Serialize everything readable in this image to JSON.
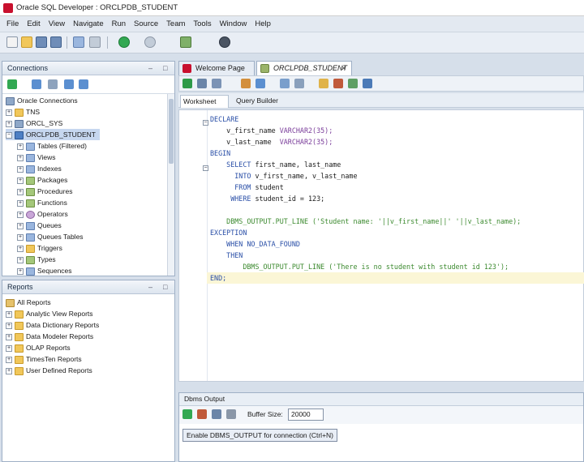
{
  "window": {
    "title": "Oracle SQL Developer : ORCLPDB_STUDENT"
  },
  "menu": [
    "File",
    "Edit",
    "View",
    "Navigate",
    "Run",
    "Source",
    "Team",
    "Tools",
    "Window",
    "Help"
  ],
  "connections": {
    "title": "Connections",
    "items": [
      {
        "label": "Oracle Connections",
        "icon": "connections-root-icon"
      },
      {
        "label": "TNS",
        "icon": "folder-icon"
      },
      {
        "label": "ORCL_SYS",
        "icon": "database-icon"
      },
      {
        "label": "ORCLPDB_STUDENT",
        "icon": "database-active-icon"
      },
      {
        "label": "Tables (Filtered)",
        "icon": "table-icon"
      },
      {
        "label": "Views",
        "icon": "view-icon"
      },
      {
        "label": "Indexes",
        "icon": "index-icon"
      },
      {
        "label": "Packages",
        "icon": "package-icon"
      },
      {
        "label": "Procedures",
        "icon": "procedure-icon"
      },
      {
        "label": "Functions",
        "icon": "function-icon"
      },
      {
        "label": "Operators",
        "icon": "operator-icon"
      },
      {
        "label": "Queues",
        "icon": "queue-icon"
      },
      {
        "label": "Queues Tables",
        "icon": "queue-table-icon"
      },
      {
        "label": "Triggers",
        "icon": "trigger-icon"
      },
      {
        "label": "Types",
        "icon": "type-icon"
      },
      {
        "label": "Sequences",
        "icon": "sequence-icon"
      }
    ]
  },
  "reports": {
    "title": "Reports",
    "items": [
      {
        "label": "All Reports"
      },
      {
        "label": "Analytic View Reports"
      },
      {
        "label": "Data Dictionary Reports"
      },
      {
        "label": "Data Modeler Reports"
      },
      {
        "label": "OLAP Reports"
      },
      {
        "label": "TimesTen Reports"
      },
      {
        "label": "User Defined Reports"
      }
    ]
  },
  "editor": {
    "tabs": [
      {
        "label": "Welcome Page"
      },
      {
        "label": "ORCLPDB_STUDENT"
      }
    ],
    "subtabs": [
      "Worksheet",
      "Query Builder"
    ],
    "code": [
      "DECLARE",
      "    v_first_name VARCHAR2(35);",
      "    v_last_name  VARCHAR2(35);",
      "BEGIN",
      "    SELECT first_name, last_name",
      "      INTO v_first_name, v_last_name",
      "      FROM student",
      "     WHERE student_id = 123;",
      "",
      "    DBMS_OUTPUT.PUT_LINE ('Student name: '||v_first_name||' '||v_last_name);",
      "EXCEPTION",
      "    WHEN NO_DATA_FOUND",
      "    THEN",
      "        DBMS_OUTPUT.PUT_LINE ('There is no student with student id 123');",
      "END;"
    ]
  },
  "dbms": {
    "title": "Dbms Output",
    "buffer_label": "Buffer Size:",
    "buffer_value": "20000",
    "tooltip": "Enable DBMS_OUTPUT for connection (Ctrl+N)"
  }
}
